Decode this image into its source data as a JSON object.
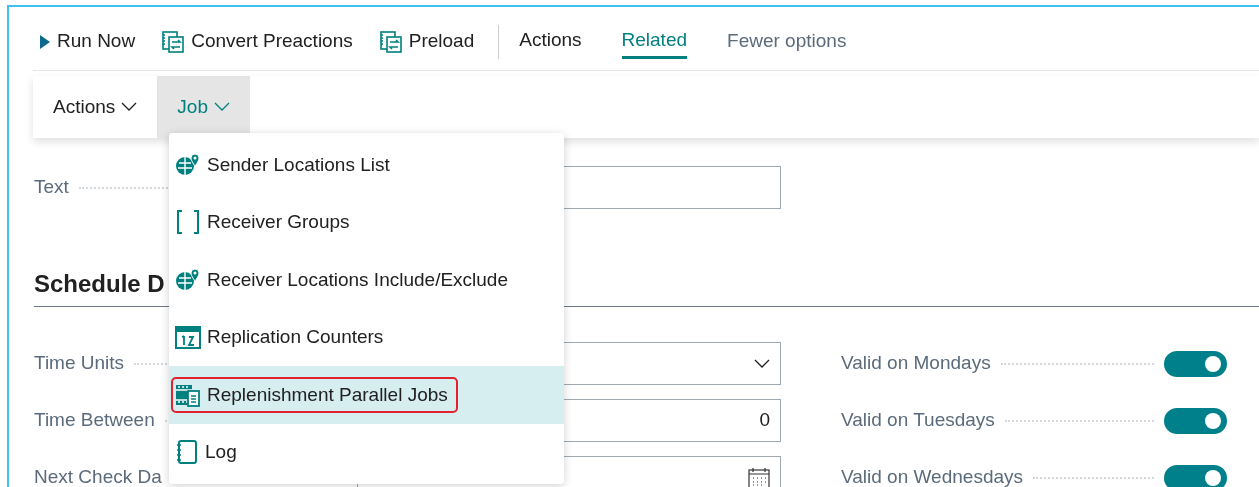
{
  "command_bar": {
    "actions": [
      {
        "kind": "run",
        "label": "Run Now"
      },
      {
        "kind": "convert",
        "label": "Convert Preactions"
      },
      {
        "kind": "convert",
        "label": "Preload"
      }
    ],
    "tabs": [
      {
        "label": "Actions",
        "selected": false
      },
      {
        "label": "Related",
        "selected": true
      }
    ],
    "fewer_options": "Fewer options"
  },
  "submenu": [
    {
      "label": "Actions",
      "selected": false
    },
    {
      "label": "Job",
      "selected": true
    }
  ],
  "dropdown": [
    {
      "kind": "globe",
      "label": "Sender Locations List",
      "selected": false,
      "annotated": false
    },
    {
      "kind": "brackets",
      "label": "Receiver Groups",
      "selected": false,
      "annotated": false
    },
    {
      "kind": "globe",
      "label": "Receiver Locations Include/Exclude",
      "selected": false,
      "annotated": false
    },
    {
      "kind": "counter",
      "label": "Replication Counters",
      "selected": false,
      "annotated": false
    },
    {
      "kind": "jobs",
      "label": "Replenishment Parallel Jobs",
      "selected": true,
      "annotated": true
    },
    {
      "kind": "log",
      "label": "Log",
      "selected": false,
      "annotated": false
    }
  ],
  "form": {
    "text_label": "Text",
    "section_title": "Schedule D",
    "fields": [
      {
        "kind": "select",
        "label": "Time Units"
      },
      {
        "kind": "number",
        "label": "Time Between",
        "value": "0"
      },
      {
        "kind": "date",
        "label": "Next Check Da"
      }
    ],
    "toggles": [
      {
        "label": "Valid on Mondays",
        "on": true
      },
      {
        "label": "Valid on Tuesdays",
        "on": true
      },
      {
        "label": "Valid on Wednesdays",
        "on": true
      }
    ]
  }
}
